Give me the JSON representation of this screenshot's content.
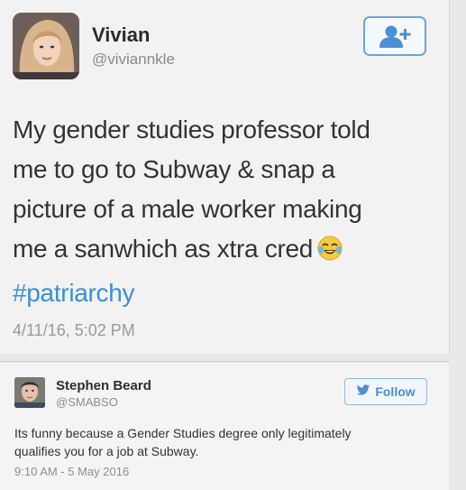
{
  "main_tweet": {
    "display_name": "Vivian",
    "handle": "@viviannkle",
    "text_lines": [
      "My gender studies professor told",
      "me to go to Subway & snap a",
      "picture of a male worker making",
      "me a sanwhich as xtra cred"
    ],
    "hashtag": "#patriarchy",
    "timestamp": "4/11/16, 5:02 PM",
    "icons": {
      "avatar": "profile-photo",
      "follow": "add-user-icon",
      "emoji": "tears-of-joy-emoji"
    }
  },
  "reply": {
    "display_name": "Stephen Beard",
    "handle": "@SMABSO",
    "follow_label": "Follow",
    "text_lines": [
      "Its funny because a Gender Studies degree only legitimately",
      "qualifies you for a job at Subway."
    ],
    "timestamp": "9:10 AM - 5 May 2016",
    "icons": {
      "avatar": "profile-photo",
      "follow": "twitter-bird-icon"
    }
  },
  "colors": {
    "accent": "#3b8fd8",
    "background": "#f2f2f2",
    "muted_text": "#9a9a9a"
  }
}
